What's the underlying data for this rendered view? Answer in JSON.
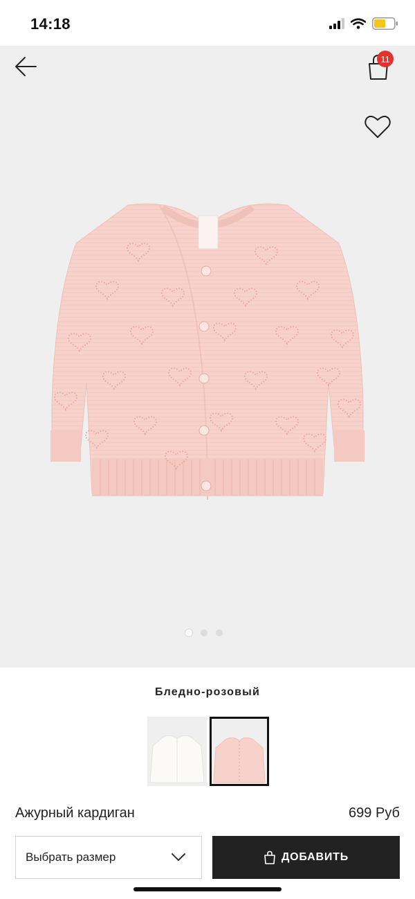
{
  "status_bar": {
    "time": "14:18",
    "icons": [
      "cellular-signal-icon",
      "wifi-icon",
      "battery-icon"
    ]
  },
  "header": {
    "back_icon": "arrow-left-icon",
    "cart_icon": "shopping-bag-icon",
    "cart_count": "11",
    "favorite_icon": "heart-outline-icon"
  },
  "gallery": {
    "image": "pink-openwork-cardigan-photo",
    "page_count": 3,
    "active_index": 0
  },
  "product": {
    "color_name": "Бледно-розовый",
    "swatches": [
      {
        "name": "white-cardigan-swatch",
        "selected": false
      },
      {
        "name": "pink-cardigan-swatch",
        "selected": true
      }
    ],
    "name": "Ажурный кардиган",
    "price": "699 Руб"
  },
  "actions": {
    "size_select_label": "Выбрать размер",
    "add_button_label": "ДОБАВИТЬ"
  },
  "colors": {
    "accent_dark": "#222222",
    "badge_red": "#e0342c",
    "cardigan_pink": "#f7d2cb",
    "background_gray": "#efefef"
  }
}
